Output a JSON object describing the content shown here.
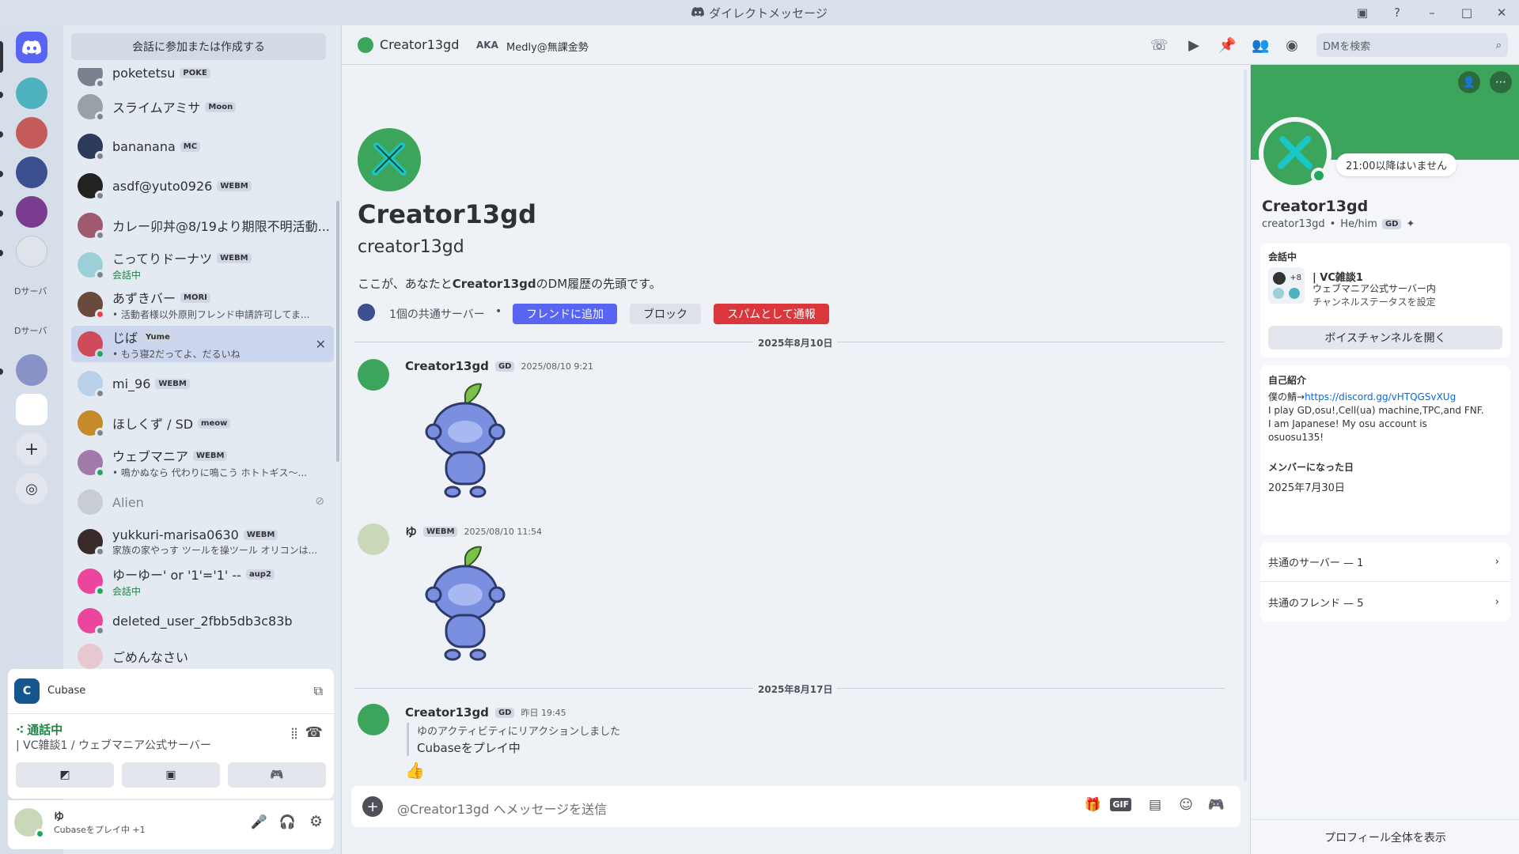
{
  "window": {
    "title": "ダイレクトメッセージ",
    "controls": [
      "inbox-icon",
      "help-icon",
      "minimize",
      "maximize",
      "close"
    ]
  },
  "guilds": {
    "items": [
      "",
      "",
      "",
      "",
      "",
      "",
      "",
      "",
      "",
      ""
    ],
    "labels": [
      "Dサーバ",
      "Dサーバ"
    ]
  },
  "dmlist": {
    "search_label": "会話に参加または作成する",
    "items": [
      {
        "name": "poketetsu",
        "tag": "POKE",
        "sub": "",
        "status": "off"
      },
      {
        "name": "スライムアミサ",
        "tag": "Moon",
        "sub": "",
        "status": "off"
      },
      {
        "name": "bananana",
        "tag": "MC",
        "sub": "",
        "status": "off"
      },
      {
        "name": "asdf@yuto0926",
        "tag": "WEBM",
        "sub": "",
        "status": "off"
      },
      {
        "name": "カレー卯丼@8/19より期限不明活動...",
        "tag": "",
        "sub": "",
        "status": "off"
      },
      {
        "name": "こってりドーナツ",
        "tag": "WEBM",
        "sub": "会話中",
        "status": "off"
      },
      {
        "name": "あずきバー",
        "tag": "MORI",
        "sub": "• 活動者様以外原則フレンド申請許可してま...",
        "status": "dnd"
      },
      {
        "name": "じば",
        "tag": "Yume",
        "sub": "• もう寝2だってよ、だるいね",
        "status": "on"
      },
      {
        "name": "mi_96",
        "tag": "WEBM",
        "sub": "",
        "status": "off"
      },
      {
        "name": "ほしくず / SD",
        "tag": "meow",
        "sub": "",
        "status": "off"
      },
      {
        "name": "ウェブマニア",
        "tag": "WEBM",
        "sub": "• 鳴かぬなら 代わりに鳴こう ホトトギス〜...",
        "status": "on"
      },
      {
        "name": "Alien",
        "tag": "",
        "sub": "",
        "status": "off"
      },
      {
        "name": "yukkuri-marisa0630",
        "tag": "WEBM",
        "sub": "家族の家やっす ツールを操ツール オリコンは...",
        "status": "off"
      },
      {
        "name": "ゆーゆー' or '1'='1' --",
        "tag": "aup2",
        "sub": "会話中",
        "status": "on"
      },
      {
        "name": "deleted_user_2fbb5db3c83b",
        "tag": "",
        "sub": "",
        "status": "off"
      },
      {
        "name": "ごめんなさい",
        "tag": "",
        "sub": "",
        "status": "off"
      }
    ]
  },
  "activity": {
    "app": "Cubase"
  },
  "voice": {
    "status": "通話中",
    "channel": "| VC雑談1 / ウェブマニア公式サーバー"
  },
  "user": {
    "name": "ゆ",
    "activity": "Cubaseをプレイ中 +1"
  },
  "header": {
    "name": "Creator13gd",
    "aka_label": "AKA",
    "aka_name": "Medly@無課金勢",
    "search_placeholder": "DMを検索"
  },
  "intro": {
    "display": "Creator13gd",
    "username": "creator13gd",
    "text_pre": "ここが、あなたと",
    "text_name": "Creator13gd",
    "text_post": "のDM履歴の先頭です。",
    "mutual": "1個の共通サーバー",
    "add_friend": "フレンドに追加",
    "block": "ブロック",
    "report": "スパムとして通報"
  },
  "messages": {
    "date1": "2025年8月10日",
    "m1": {
      "author": "Creator13gd",
      "tag": "GD",
      "time": "2025/08/10 9:21"
    },
    "m2": {
      "author": "ゆ",
      "tag": "WEBM",
      "time": "2025/08/10 11:54"
    },
    "date2": "2025年8月17日",
    "m3": {
      "author": "Creator13gd",
      "tag": "GD",
      "time": "昨日 19:45",
      "reply_line1": "ゆのアクティビティにリアクションしました",
      "reply_line2": "Cubaseをプレイ中",
      "reaction": "👍"
    }
  },
  "composer": {
    "placeholder": "@Creator13gd へメッセージを送信"
  },
  "profile": {
    "status_bubble": "21:00以降はいません",
    "display": "Creator13gd",
    "username": "creator13gd",
    "pronouns": "He/him",
    "tag": "GD",
    "voice_label": "会話中",
    "voice_channel": "| VC雑談1",
    "voice_server": "ウェブマニア公式サーバー内",
    "voice_status": "チャンネルステータスを設定",
    "voice_count": "+8",
    "open_voice": "ボイスチャンネルを開く",
    "about_label": "自己紹介",
    "about_line1_pre": "僕の鯖→",
    "about_link": "https://discord.gg/vHTQGSvXUg",
    "about_line2": "I play GD,osu!,Cell(ua) machine,TPC,and FNF.",
    "about_line3": "I am Japanese! My osu account is",
    "about_line4": "osuosu135!",
    "member_label": "メンバーになった日",
    "member_date": "2025年7月30日",
    "mutual_servers": "共通のサーバー — 1",
    "mutual_friends": "共通のフレンド — 5",
    "view_full": "プロフィール全体を表示"
  },
  "colors": {
    "accent": "#5865f2",
    "green": "#23a55a",
    "red": "#da373c",
    "banner": "#3ba55c"
  }
}
